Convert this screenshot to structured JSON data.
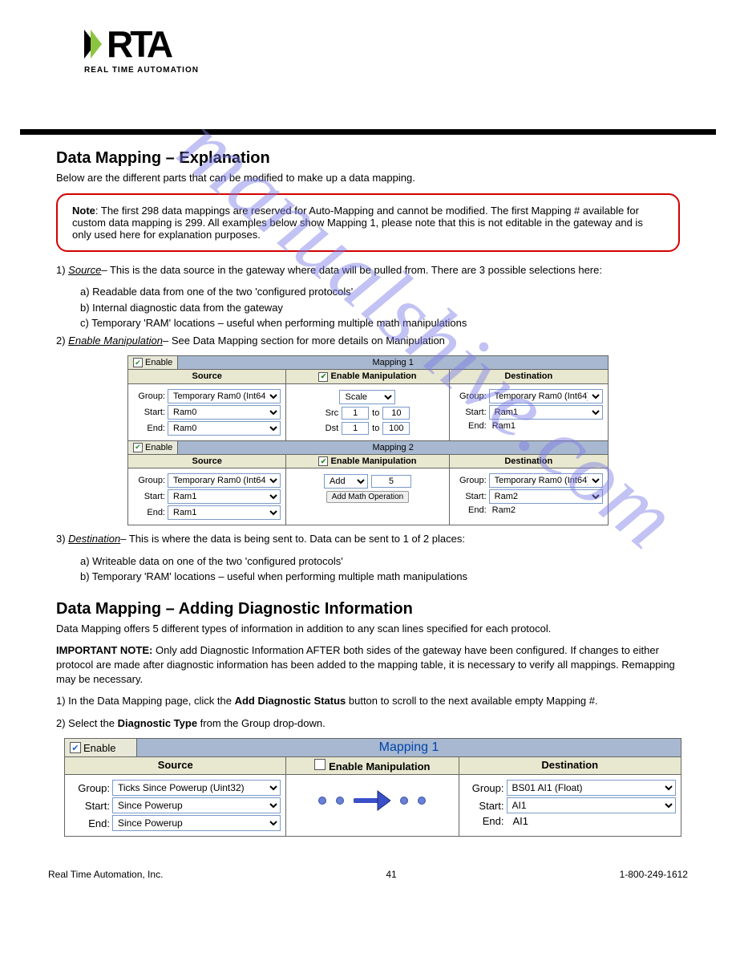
{
  "logo": {
    "main": "RTA",
    "sub": "REAL TIME AUTOMATION"
  },
  "watermark": "manualshive.com",
  "section1": {
    "title": "Data Mapping – Explanation",
    "intro": "Below are the different parts that can be modified to make up a data mapping.",
    "note": {
      "label": "Note",
      "text": ": The first 298 data mappings are reserved for Auto-Mapping and cannot be modified. The first Mapping # available for custom data mapping is 299. All examples below show Mapping 1, please note that this is not editable in the gateway and is only used here for explanation purposes."
    },
    "list_intro_src": "– This is the data source in the gateway where data will be pulled from. There are 3 possible selections here:",
    "list_intro_dst": "– This is where the data is being sent to. Data can be sent to 1 of 2 places:",
    "src_label": "Source",
    "dst_label": "Destination",
    "manip_label": "Enable Manipulation",
    "item1_letters": {
      "a": "a) Readable data from one of the two 'configured protocols'",
      "b": "b) Internal diagnostic data from the gateway",
      "c": "c) Temporary 'RAM' locations – useful when performing multiple math manipulations"
    },
    "item3_letters": {
      "a": "a) Writeable data on one of the two 'configured protocols'",
      "b": "b) Temporary 'RAM' locations – useful when performing multiple math manipulations"
    },
    "manip_desc": "– See Data Mapping section for more details on Manipulation"
  },
  "section2": {
    "title": "Data Mapping – Adding Diagnostic Information",
    "p1": "Data Mapping offers 5 different types of information in addition to any scan lines specified for each protocol.",
    "important_label": "IMPORTANT NOTE:",
    "important_text": " Only add Diagnostic Information AFTER both sides of the gateway have been configured. If changes to either protocol are made after diagnostic information has been added to the mapping table, it is necessary to verify all mappings. Remapping may be necessary.",
    "steps": {
      "s1": "In the Data Mapping page, click the ",
      "s1b": "Add Diagnostic Status",
      "s1c": " button to scroll to the next available empty Mapping #.",
      "s2": "Select the ",
      "s2b": "Diagnostic Type",
      "s2c": " from the Group drop-down."
    }
  },
  "mapping1": {
    "enable_label": "Enable",
    "title": "Mapping 1",
    "headers": {
      "src": "Source",
      "mid": "Enable Manipulation",
      "dst": "Destination"
    },
    "labels": {
      "group": "Group:",
      "start": "Start:",
      "end": "End:",
      "src": "Src",
      "dst": "Dst",
      "to": "to"
    },
    "src": {
      "group": "Temporary Ram0 (Int64)",
      "start": "Ram0",
      "end": "Ram0"
    },
    "manip": {
      "type": "Scale",
      "src_from": "1",
      "src_to": "10",
      "dst_from": "1",
      "dst_to": "100"
    },
    "dst": {
      "group": "Temporary Ram0 (Int64)",
      "start": "Ram1",
      "end": "Ram1"
    }
  },
  "mapping2": {
    "enable_label": "Enable",
    "title": "Mapping 2",
    "headers": {
      "src": "Source",
      "mid": "Enable Manipulation",
      "dst": "Destination"
    },
    "labels": {
      "group": "Group:",
      "start": "Start:",
      "end": "End:"
    },
    "src": {
      "group": "Temporary Ram0 (Int64)",
      "start": "Ram1",
      "end": "Ram1"
    },
    "manip": {
      "op": "Add",
      "val": "5",
      "btn": "Add Math Operation"
    },
    "dst": {
      "group": "Temporary Ram0 (Int64)",
      "start": "Ram2",
      "end": "Ram2"
    }
  },
  "mapping3": {
    "enable_label": "Enable",
    "title": "Mapping 1",
    "headers": {
      "src": "Source",
      "mid": "Enable Manipulation",
      "dst": "Destination"
    },
    "labels": {
      "group": "Group:",
      "start": "Start:",
      "end": "End:"
    },
    "src": {
      "group": "Ticks Since Powerup (Uint32)",
      "start": "Since Powerup",
      "end": "Since Powerup"
    },
    "dst": {
      "group": "BS01 AI1 (Float)",
      "start": "AI1",
      "end": "AI1"
    }
  },
  "footer": {
    "left": "Real Time Automation, Inc.",
    "mid": "41",
    "right": "1-800-249-1612"
  }
}
